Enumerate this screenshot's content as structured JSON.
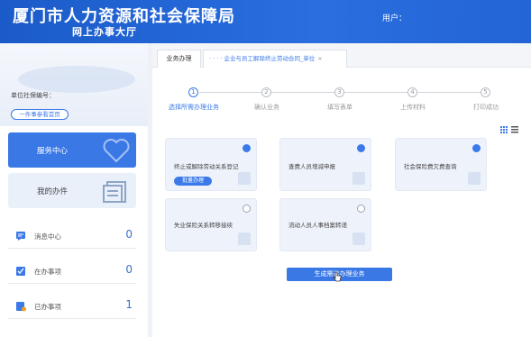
{
  "header": {
    "title": "厦门市人力资源和社会保障局",
    "subtitle": "网上办事大厅",
    "user_label": "用户："
  },
  "sidebar": {
    "id_label": "单位社保编号：",
    "home_button": "一件事参看首页",
    "service_center": "服务中心",
    "my_work": "我的办件",
    "stats": [
      {
        "label": "消息中心",
        "count": "0",
        "icon": "message-icon"
      },
      {
        "label": "在办事项",
        "count": "0",
        "icon": "in-progress-icon"
      },
      {
        "label": "已办事项",
        "count": "1",
        "icon": "done-icon"
      }
    ]
  },
  "tabs": [
    {
      "label": "业务办理"
    },
    {
      "label": "企业与员工解除终止劳动合同_单位",
      "prefix": "· · · ·",
      "close": "×"
    }
  ],
  "steps": [
    {
      "num": "1",
      "label": "选择所需办理业务",
      "active": true
    },
    {
      "num": "2",
      "label": "确认业务",
      "active": false
    },
    {
      "num": "3",
      "label": "填写表单",
      "active": false
    },
    {
      "num": "4",
      "label": "上传材料",
      "active": false
    },
    {
      "num": "5",
      "label": "打印成功",
      "active": false
    }
  ],
  "cards": [
    {
      "title": "终止或解除劳动关系登记",
      "checked": true,
      "badge": "批量办理"
    },
    {
      "title": "查费人员增减申报",
      "checked": true
    },
    {
      "title": "社会保险费欠费查询",
      "checked": true
    },
    {
      "title": "失业保险关系转移接续",
      "checked": false
    },
    {
      "title": "流动人员人事档案转递",
      "checked": false
    }
  ],
  "generate_button": "生成需选办理业务",
  "colors": {
    "brand_blue": "#2364d6",
    "accent_blue": "#3b7ae8"
  }
}
